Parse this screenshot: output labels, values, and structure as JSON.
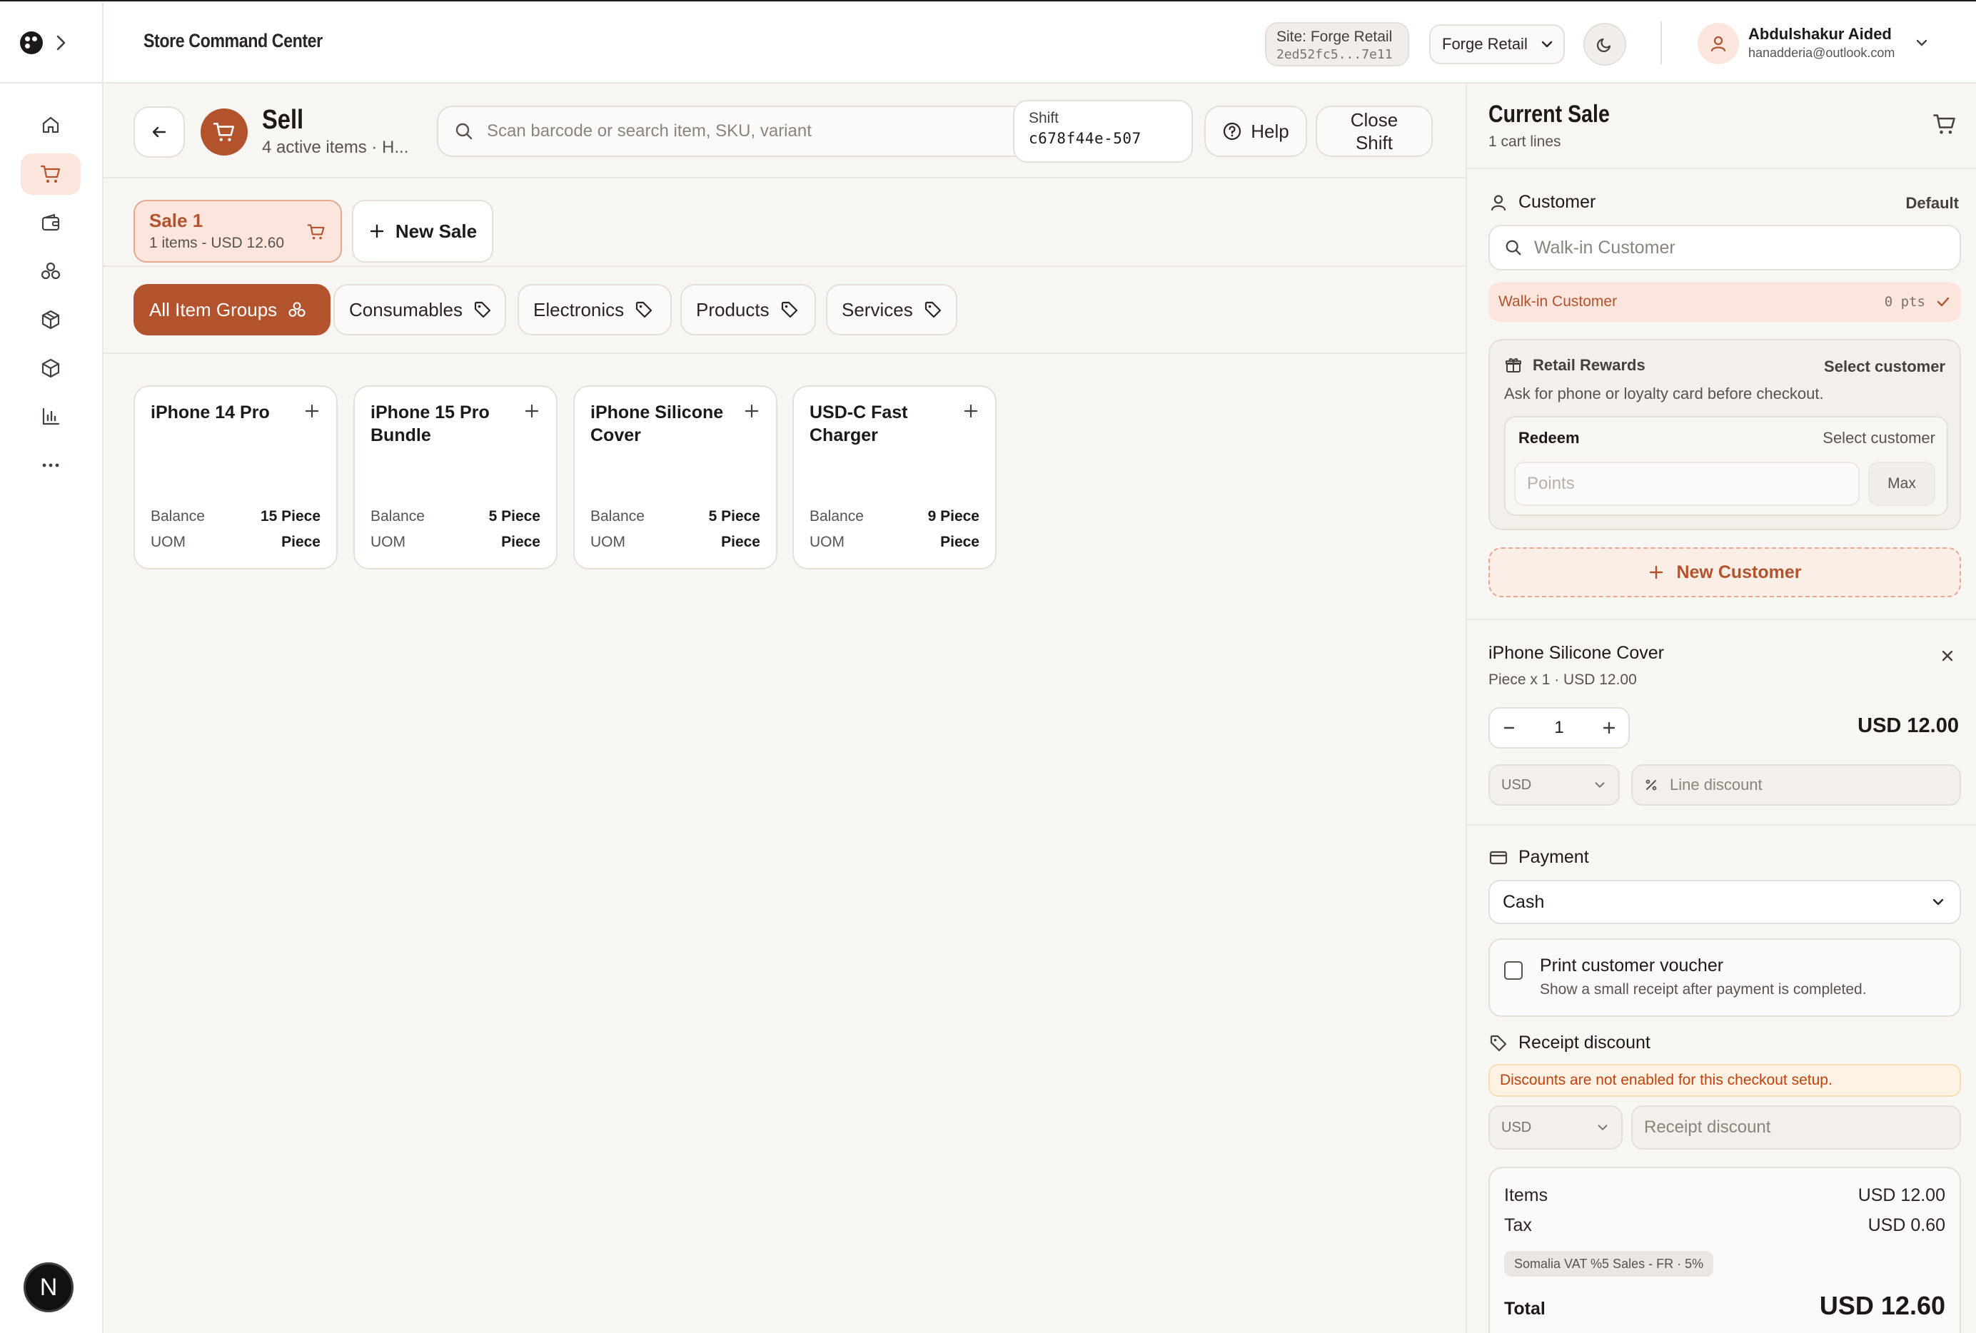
{
  "topbar": {
    "app_title": "Store Command Center",
    "site_label": "Site: Forge Retail",
    "site_id": "2ed52fc5...7e11",
    "company": "Forge Retail",
    "user_name": "Abdulshakur Aided",
    "user_email": "hanadderia@outlook.com"
  },
  "sidebar": {
    "items": [
      {
        "icon": "home-icon"
      },
      {
        "icon": "cart-icon",
        "active": true
      },
      {
        "icon": "wallet-icon"
      },
      {
        "icon": "boxes-icon"
      },
      {
        "icon": "package-check-icon"
      },
      {
        "icon": "package-icon"
      },
      {
        "icon": "bar-chart-icon"
      },
      {
        "icon": "more-icon"
      }
    ],
    "avatar_letter": "N"
  },
  "header": {
    "title": "Sell",
    "subtitle": "4 active items · H...",
    "search_placeholder": "Scan barcode or search item, SKU, variant",
    "shift_label": "Shift",
    "shift_id": "c678f44e-507",
    "help_label": "Help",
    "close_shift_line1": "Close",
    "close_shift_line2": "Shift"
  },
  "sales": {
    "current": {
      "name": "Sale 1",
      "summary": "1 items - USD 12.60"
    },
    "new_sale_label": "New Sale"
  },
  "groups": [
    {
      "label": "All Item Groups",
      "active": true
    },
    {
      "label": "Consumables"
    },
    {
      "label": "Electronics"
    },
    {
      "label": "Products"
    },
    {
      "label": "Services"
    }
  ],
  "items": [
    {
      "name": "iPhone 14 Pro",
      "balance_label": "Balance",
      "balance": "15 Piece",
      "uom_label": "UOM",
      "uom": "Piece"
    },
    {
      "name": "iPhone 15 Pro Bundle",
      "balance_label": "Balance",
      "balance": "5 Piece",
      "uom_label": "UOM",
      "uom": "Piece"
    },
    {
      "name": "iPhone Silicone Cover",
      "balance_label": "Balance",
      "balance": "5 Piece",
      "uom_label": "UOM",
      "uom": "Piece"
    },
    {
      "name": "USD-C Fast Charger",
      "balance_label": "Balance",
      "balance": "9 Piece",
      "uom_label": "UOM",
      "uom": "Piece"
    }
  ],
  "cart": {
    "title": "Current Sale",
    "lines_count": "1 cart lines",
    "customer": {
      "label": "Customer",
      "default_label": "Default",
      "search_placeholder": "Walk-in Customer",
      "selected": "Walk-in Customer",
      "points": "0 pts"
    },
    "rewards": {
      "title": "Retail Rewards",
      "action": "Select customer",
      "description": "Ask for phone or loyalty card before checkout.",
      "redeem_label": "Redeem",
      "redeem_action": "Select customer",
      "points_placeholder": "Points",
      "max_label": "Max"
    },
    "new_customer_label": "New Customer",
    "line": {
      "name": "iPhone Silicone Cover",
      "detail": "Piece x 1 · USD 12.00",
      "qty": "1",
      "total": "USD 12.00",
      "currency": "USD",
      "discount_placeholder": "Line discount"
    },
    "payment": {
      "label": "Payment",
      "method": "Cash"
    },
    "voucher": {
      "title": "Print customer voucher",
      "subtitle": "Show a small receipt after payment is completed.",
      "checked": false
    },
    "receipt_discount": {
      "label": "Receipt discount",
      "warning": "Discounts are not enabled for this checkout setup.",
      "currency": "USD",
      "placeholder": "Receipt discount"
    },
    "totals": {
      "items_label": "Items",
      "items_value": "USD 12.00",
      "tax_label": "Tax",
      "tax_value": "USD 0.60",
      "tax_badge": "Somalia VAT %5 Sales - FR · 5%",
      "total_label": "Total",
      "total_value": "USD 12.60"
    }
  },
  "colors": {
    "accent": "#b3532e",
    "accent_soft": "#fbe5dc",
    "background": "#f8f6f3",
    "border": "#e5dfd8"
  }
}
